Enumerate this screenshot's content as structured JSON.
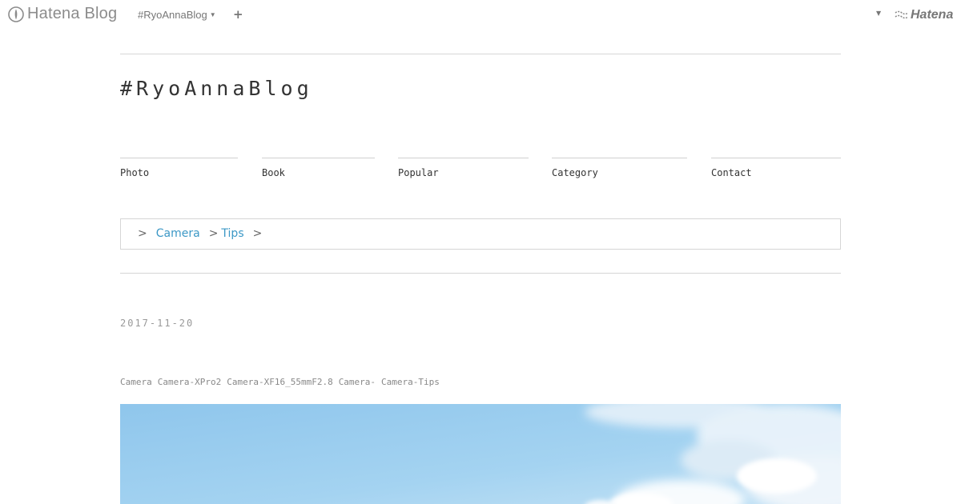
{
  "topbar": {
    "brand_text": "Hatena Blog",
    "blog_switch": "#RyoAnnaBlog",
    "plus_label": "+",
    "hatena_text": "Hatena"
  },
  "site": {
    "title": "#RyoAnnaBlog"
  },
  "nav": [
    {
      "label": "Photo"
    },
    {
      "label": "Book"
    },
    {
      "label": "Popular"
    },
    {
      "label": "Category"
    },
    {
      "label": "Contact"
    }
  ],
  "breadcrumb": {
    "separator": ">",
    "items": [
      "Camera",
      "Tips"
    ]
  },
  "entry": {
    "date": "2017-11-20",
    "categories": [
      "Camera",
      "Camera-XPro2",
      "Camera-XF16_55mmF2.8",
      "Camera-",
      "Camera-Tips"
    ]
  },
  "colors": {
    "link": "#3c98c6",
    "sky": "#9ccfee"
  }
}
